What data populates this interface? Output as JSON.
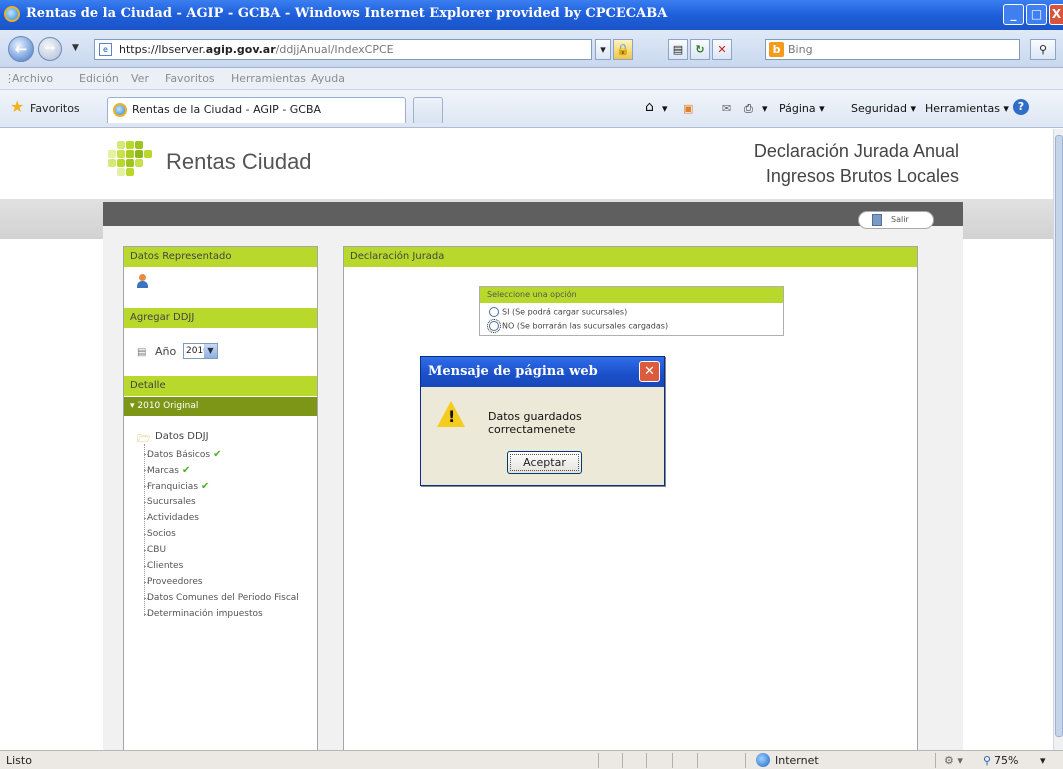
{
  "window": {
    "title": "Rentas de la Ciudad - AGIP - GCBA - Windows Internet Explorer provided by CPCECABA",
    "controls": {
      "minimize": "_",
      "maximize": "□",
      "close": "X"
    }
  },
  "address": {
    "url_prefix": "https://lbserver.",
    "url_domain": "agip.gov.ar",
    "url_path": "/ddjjAnual/IndexCPCE",
    "search_placeholder": "Bing"
  },
  "menu": [
    "Archivo",
    "Edición",
    "Ver",
    "Favoritos",
    "Herramientas",
    "Ayuda"
  ],
  "favorites_bar": {
    "favorites_label": "Favoritos",
    "tab_title": "Rentas de la Ciudad - AGIP - GCBA",
    "commands": [
      "Página ▾",
      "Seguridad ▾",
      "Herramientas ▾"
    ]
  },
  "page": {
    "brand": "Rentas Ciudad",
    "header_line1": "Declaración Jurada Anual",
    "header_line2": "Ingresos Brutos Locales",
    "logout": "Salir",
    "sidebar": {
      "datos_representado": "Datos Representado",
      "agregar_ddjj": "Agregar DDJJ",
      "anio_label": "Año",
      "anio_value": "2010",
      "detalle": "Detalle",
      "version": "▾ 2010 Original",
      "folder": "Datos DDJJ",
      "items": [
        "Datos Básicos",
        "Marcas",
        "Franquicias",
        "Sucursales",
        "Actividades",
        "Socios",
        "CBU",
        "Clientes",
        "Proveedores",
        "Datos Comunes del Periodo Fiscal",
        "Determinación impuestos"
      ],
      "checked_items": [
        "Datos Básicos",
        "Marcas",
        "Franquicias"
      ]
    },
    "main": {
      "title": "Declaración Jurada",
      "options_header": "Seleccione una opción",
      "option_si": "SI (Se podrá cargar sucursales)",
      "option_no": "NO (Se borrarán las sucursales cargadas)",
      "selected": "NO"
    }
  },
  "dialog": {
    "title": "Mensaje de página web",
    "message": "Datos guardados correctamenete",
    "button": "Aceptar"
  },
  "statusbar": {
    "status": "Listo",
    "zone": "Internet",
    "zoom": "75%"
  },
  "colors": {
    "accent_green": "#b9d82c",
    "dark_green": "#7e9618",
    "titlebar_blue": "#1f5fdb"
  }
}
